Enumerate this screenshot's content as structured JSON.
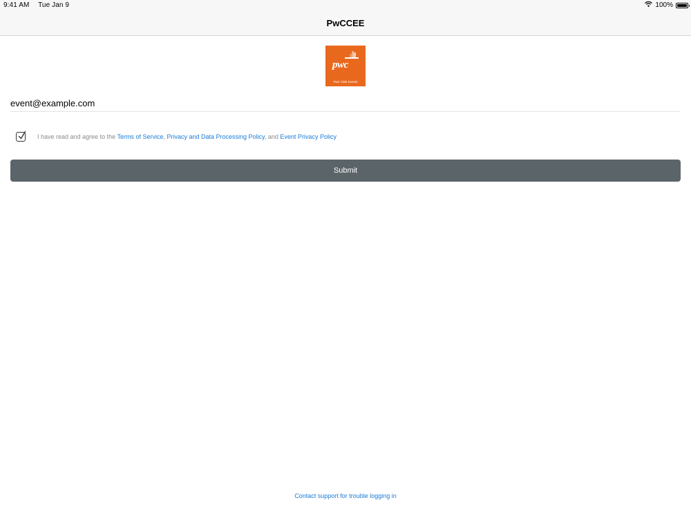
{
  "status_bar": {
    "time": "9:41 AM",
    "date": "Tue Jan 9",
    "battery_percent": "100%",
    "wifi_icon": "wifi-icon",
    "battery_icon": "battery-icon"
  },
  "nav": {
    "title": "PwCCEE"
  },
  "logo": {
    "wordmark": "pwc",
    "subtitle": "PwC CEE Events",
    "background": "#e8691e"
  },
  "form": {
    "email_value": "event@example.com",
    "checkbox_checked": true,
    "agree_prefix": "I have read and agree to the ",
    "terms_link": "Terms of Service",
    "separator": ", ",
    "privacy_link": "Privacy and Data Processing Policy",
    "and_text": ", and ",
    "event_privacy_link": "Event Privacy Policy",
    "submit_label": "Submit"
  },
  "footer": {
    "support_link": "Contact support for trouble logging in"
  },
  "colors": {
    "accent_link": "#1a7bd6",
    "button_bg": "#5a6469",
    "brand_orange": "#e8691e"
  }
}
